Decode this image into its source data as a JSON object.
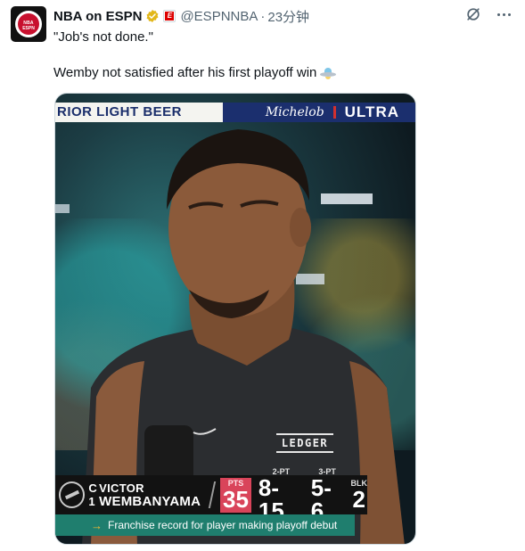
{
  "post": {
    "display_name": "NBA on ESPN",
    "handle": "@ESPNNBA",
    "time": "23分钟",
    "text_line1": "\"Job's not done.\"",
    "text_line2": "Wemby not satisfied after his first playoff win"
  },
  "icons": {
    "avatar": "nba-espn-logo",
    "verified": "gold-verified-badge",
    "affiliate": "espn-affiliate-badge",
    "grok": "grok-icon",
    "more": "more-options-icon",
    "emoji": "flying-saucer-emoji"
  },
  "media": {
    "banner_left": "RIOR LIGHT BEER",
    "banner_brand": "Michelob",
    "banner_right": "ULTRA",
    "jersey_sponsor": "LEDGER",
    "lower_third": {
      "position": [
        "C",
        "1"
      ],
      "first_name": "VICTOR",
      "last_name": "WEMBANYAMA",
      "stats": [
        {
          "label": "PTS",
          "value": "35"
        },
        {
          "label": "2-PT",
          "value": "8-15"
        },
        {
          "label": "3-PT",
          "value": "5-6"
        },
        {
          "label": "BLK",
          "value": "2"
        }
      ],
      "note": "Franchise record for player making playoff debut"
    }
  },
  "colors": {
    "verified_gold": "#e2b719",
    "pts_highlight": "#d9445a",
    "note_bar": "#1f7e6e",
    "banner_navy": "#1b2f6e"
  }
}
